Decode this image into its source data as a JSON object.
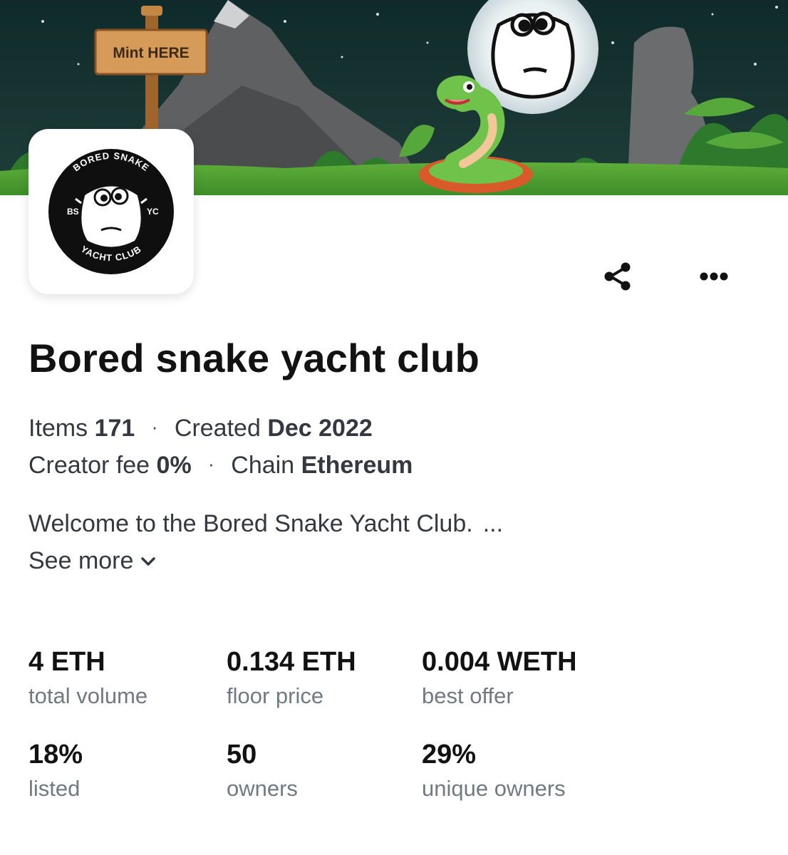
{
  "banner": {
    "sign_text": "Mint HERE"
  },
  "logo": {
    "top_text": "BORED SNAKE",
    "bottom_text": "YACHT CLUB",
    "left_text": "BS",
    "right_text": "YC"
  },
  "actions": {
    "share_icon": "share-icon",
    "more_icon": "more-options-icon"
  },
  "collection": {
    "title": "Bored snake yacht club",
    "items_label": "Items",
    "items_value": "171",
    "created_label": "Created",
    "created_value": "Dec 2022",
    "creator_fee_label": "Creator fee",
    "creator_fee_value": "0%",
    "chain_label": "Chain",
    "chain_value": "Ethereum",
    "separator": "·",
    "description": "Welcome to the Bored Snake Yacht Club.",
    "ellipsis": "...",
    "see_more": "See more"
  },
  "stats": [
    {
      "value": "4 ETH",
      "label": "total volume"
    },
    {
      "value": "0.134 ETH",
      "label": "floor price"
    },
    {
      "value": "0.004 WETH",
      "label": "best offer"
    },
    {
      "value": "18%",
      "label": "listed"
    },
    {
      "value": "50",
      "label": "owners"
    },
    {
      "value": "29%",
      "label": "unique owners"
    }
  ],
  "colors": {
    "text_primary": "#121212",
    "text_secondary": "#353840",
    "text_muted": "#707a83"
  }
}
